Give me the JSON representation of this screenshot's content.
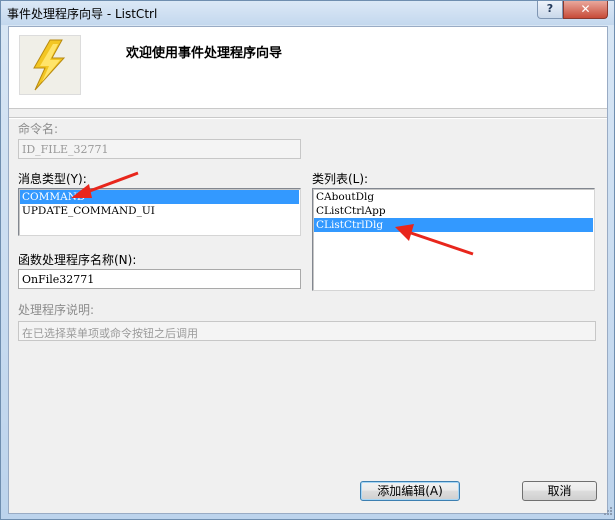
{
  "window": {
    "title": "事件处理程序向导 - ListCtrl",
    "help_label": "?",
    "close_label": "✕"
  },
  "banner": {
    "title": "欢迎使用事件处理程序向导",
    "icon": "lightning-icon"
  },
  "command_name": {
    "label": "命令名:",
    "value": "ID_FILE_32771"
  },
  "message_type": {
    "label": "消息类型(Y):",
    "items": [
      "COMMAND",
      "UPDATE_COMMAND_UI"
    ],
    "selected": "COMMAND"
  },
  "class_list": {
    "label": "类列表(L):",
    "items": [
      "CAboutDlg",
      "CListCtrlApp",
      "CListCtrlDlg"
    ],
    "selected": "CListCtrlDlg"
  },
  "handler_name": {
    "label": "函数处理程序名称(N):",
    "value": "OnFile32771"
  },
  "handler_desc": {
    "label": "处理程序说明:",
    "value": "在已选择菜单项或命令按钮之后调用"
  },
  "buttons": {
    "add_edit": "添加编辑(A)",
    "cancel": "取消"
  },
  "colors": {
    "selection": "#3399ff",
    "annotation_arrow": "#e8261c"
  }
}
